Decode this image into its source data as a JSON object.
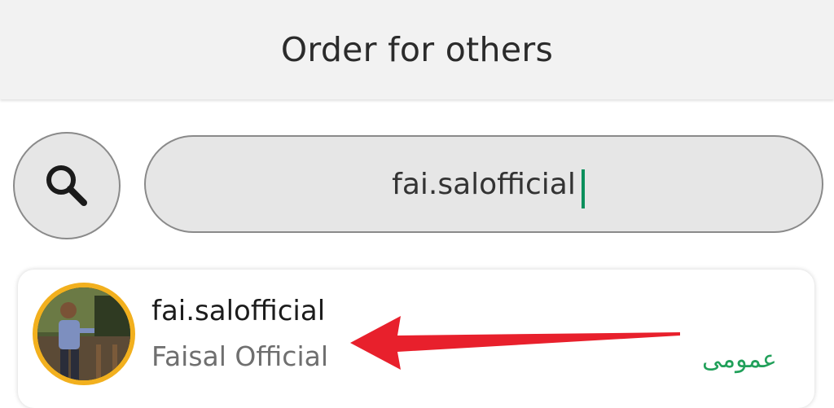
{
  "header": {
    "title": "Order for others"
  },
  "search": {
    "icon": "search-icon",
    "value": "fai.salofficial",
    "caret_color": "#0a8f5c"
  },
  "result": {
    "username": "fai.salofficial",
    "full_name": "Faisal Official",
    "privacy_label": "عمومی",
    "avatar_border_color": "#f2b01e",
    "privacy_color": "#21a05a"
  },
  "annotation": {
    "arrow_color": "#e8202c",
    "arrow": "arrow-left"
  }
}
